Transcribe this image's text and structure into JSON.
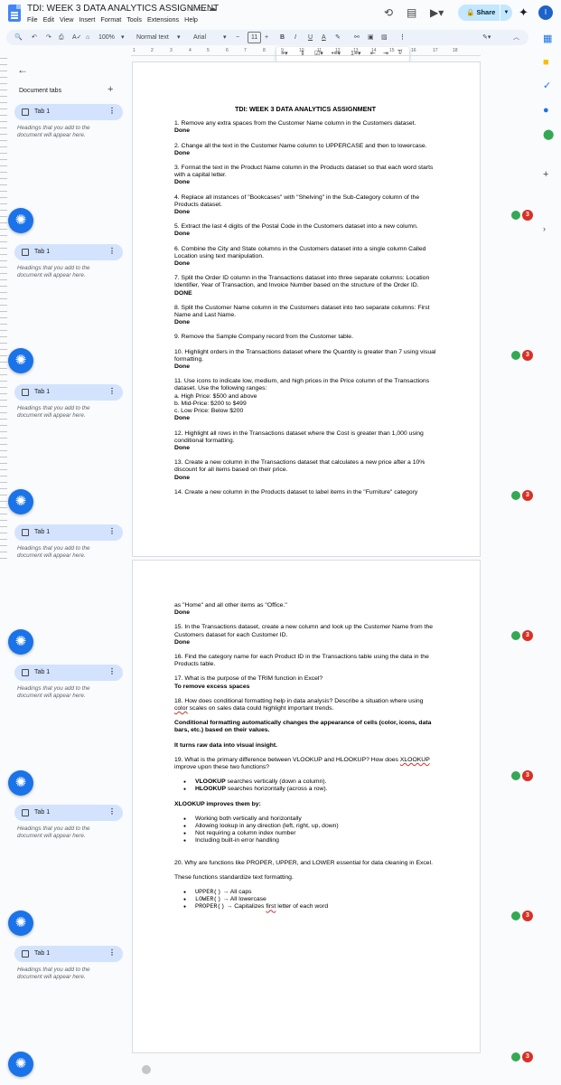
{
  "header": {
    "title": "TDI: WEEK 3 DATA ANALYTICS ASSIGNMENT",
    "menu": [
      "File",
      "Edit",
      "View",
      "Insert",
      "Format",
      "Tools",
      "Extensions",
      "Help"
    ],
    "share_label": "Share",
    "avatar_letter": "I"
  },
  "toolbar": {
    "zoom": "100%",
    "style": "Normal text",
    "font": "Arial",
    "size": "11"
  },
  "ruler": {
    "ticks": [
      "1",
      "2",
      "3",
      "4",
      "5",
      "6",
      "7",
      "8",
      "9",
      "10",
      "11",
      "12",
      "13",
      "14",
      "15",
      "16",
      "17",
      "18"
    ]
  },
  "sidebar": {
    "heading": "Document tabs",
    "tab_label": "Tab 1",
    "hint": "Headings that you add to the document will appear here.",
    "badge": "3"
  },
  "doc": {
    "title": "TDI: WEEK 3 DATA ANALYTICS ASSIGNMENT",
    "q1": "1. Remove any extra spaces from the Customer Name column in the Customers dataset.",
    "d1": "Done",
    "q2": "2. Change all the text in the Customer Name column to UPPERCASE and then to lowercase.",
    "d2": "Done",
    "q3": "3. Format the text in the Product Name column in the Products dataset so that each word starts with a capital letter.",
    "d3": "Done",
    "q4": "4. Replace all instances of \"Bookcases\" with \"Shelving\" in the Sub-Category column of the Products dataset.",
    "d4": "Done",
    "q5": "5. Extract the last 4 digits of the Postal Code in the Customers dataset into a new column.",
    "d5": "Done",
    "q6": "6. Combine the City and State columns in the Customers dataset into a single column Called Location using text manipulation.",
    "d6": "Done",
    "q7": "7. Split the Order ID column in the Transactions dataset into three separate columns: Location Identifier, Year of Transaction, and Invoice Number based on the structure of the Order ID.",
    "d7": "DONE",
    "q8": "8. Split the Customer Name column in the Customers dataset into two separate columns: First Name and Last Name.",
    "d8": "Done",
    "q9": "9. Remove the Sample Company record from the Customer table.",
    "q10": "10. Highlight orders in the Transactions dataset where the Quantity is greater than 7 using visual formatting.",
    "d10": "Done",
    "q11": "11. Use icons to indicate low, medium, and high prices in the Price column of the Transactions dataset. Use the following ranges:",
    "q11a": "a. High Price: $500 and above",
    "q11b": "b. Mid-Price: $200 to $499",
    "q11c": "c. Low Price: Below $200",
    "d11": "Done",
    "q12": "12. Highlight all rows in the Transactions dataset where the Cost is greater than 1,000 using conditional formatting.",
    "d12": "Done",
    "q13": "13. Create a new column in the Transactions dataset that calculates a new price after a 10% discount for all items based on their price.",
    "d13": "Done",
    "q14": "14. Create a new column in the Products dataset to label items in the \"Furniture\" category",
    "q14b": "as \"Home\" and all other items as \"Office.\"",
    "d14": "Done",
    "q15": "15. In the Transactions dataset, create a new column and look up the Customer Name from the Customers dataset for each Customer ID.",
    "d15": "Done",
    "q16": "16. Find the category name for each Product ID in the Transactions table using the data in the Products table.",
    "q17": "17. What is the purpose of the TRIM function in Excel?",
    "a17": "To remove excess spaces",
    "q18a": "18. How does conditional formatting help in data analysis? Describe a situation where using ",
    "q18w": "color",
    "q18b": " scales on sales data could highlight important trends.",
    "a18": "Conditional formatting automatically changes the appearance of cells (color, icons, data bars, etc.) based on their values.",
    "a18b": "It turns raw data into visual insight.",
    "q19a": "19. What is the primary difference between VLOOKUP and HLOOKUP? How does ",
    "q19w": "XLOOKUP",
    "q19b": " improve upon these two functions?",
    "v_b": "VLOOKUP",
    "v_t": " searches vertically (down a column).",
    "h_b": "HLOOKUP",
    "h_t": " searches horizontally (across a row).",
    "x_head": "XLOOKUP improves them by:",
    "x1": "Working both vertically and horizontally",
    "x2": "Allowing lookup in any direction (left, right, up, down)",
    "x3": "Not requiring a column index number",
    "x4": "Including built-in error handling",
    "q20": "20. Why are functions like PROPER, UPPER, and LOWER essential for data cleaning in Excel.",
    "a20": "These functions standardize text formatting.",
    "f1c": "UPPER()",
    "f1t": " → All caps",
    "f2c": "LOWER()",
    "f2t": " → All lowercase",
    "f3c": "PROPER()",
    "f3t": " → Capitalizes ",
    "f3w": "first",
    "f3u": " letter of each word"
  }
}
